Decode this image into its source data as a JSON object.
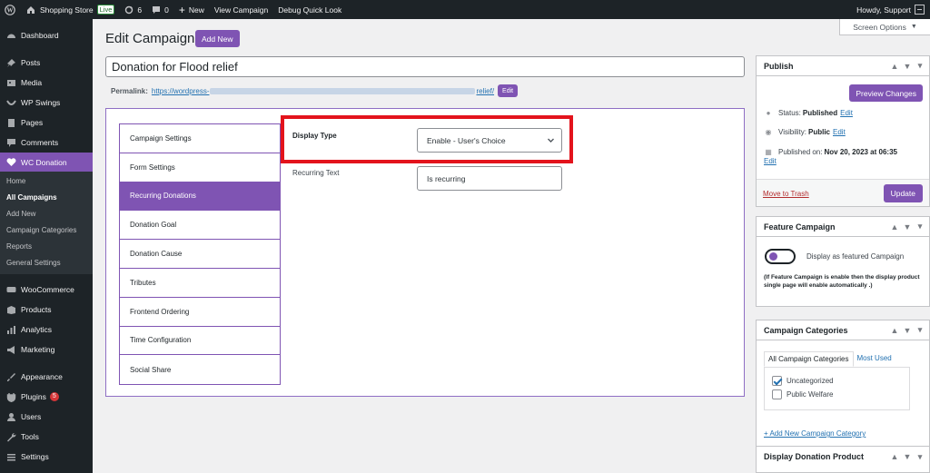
{
  "adminbar": {
    "site_name": "Shopping Store",
    "live_badge": "Live",
    "updates_count": "6",
    "comments_count": "0",
    "new_label": "New",
    "view_campaign": "View Campaign",
    "debug": "Debug Quick Look",
    "howdy": "Howdy, Support"
  },
  "sidebar": {
    "dashboard": "Dashboard",
    "posts": "Posts",
    "media": "Media",
    "wp_swings": "WP Swings",
    "pages": "Pages",
    "comments": "Comments",
    "wc_donation": "WC Donation",
    "sub": {
      "home": "Home",
      "all_campaigns": "All Campaigns",
      "add_new": "Add New",
      "campaign_categories": "Campaign Categories",
      "reports": "Reports",
      "general_settings": "General Settings"
    },
    "woocommerce": "WooCommerce",
    "products": "Products",
    "analytics": "Analytics",
    "marketing": "Marketing",
    "appearance": "Appearance",
    "plugins": "Plugins",
    "plugins_badge": "5",
    "users": "Users",
    "tools": "Tools",
    "settings": "Settings"
  },
  "header": {
    "title": "Edit Campaign",
    "add_new": "Add New",
    "screen_options": "Screen Options"
  },
  "post": {
    "title_value": "Donation for Flood relief",
    "permalink_label": "Permalink:",
    "permalink_start": "https://wordpress-",
    "permalink_end": "relief/",
    "edit_label": "Edit"
  },
  "campaign": {
    "tabs": [
      "Campaign Settings",
      "Form Settings",
      "Recurring Donations",
      "Donation Goal",
      "Donation Cause",
      "Tributes",
      "Frontend Ordering",
      "Time Configuration",
      "Social Share"
    ],
    "active_tab": "Recurring Donations",
    "display_type_label": "Display Type",
    "display_type_value": "Enable - User's Choice",
    "recurring_text_label": "Recurring Text",
    "recurring_text_value": "Is recurring"
  },
  "publish": {
    "heading": "Publish",
    "preview": "Preview Changes",
    "status_label": "Status:",
    "status_value": "Published",
    "visibility_label": "Visibility:",
    "visibility_value": "Public",
    "published_label": "Published on:",
    "published_value": "Nov 20, 2023 at 06:35",
    "edit": "Edit",
    "trash": "Move to Trash",
    "update": "Update"
  },
  "feature": {
    "heading": "Feature Campaign",
    "toggle_label": "Display as featured Campaign",
    "toggle_on": true,
    "note": "(If Feature Campaign is enable then the display product single page will enable automatically .)"
  },
  "categories": {
    "heading": "Campaign Categories",
    "tab_all": "All Campaign Categories",
    "tab_most": "Most Used",
    "items": [
      {
        "label": "Uncategorized",
        "checked": true
      },
      {
        "label": "Public Welfare",
        "checked": false
      }
    ],
    "add_new": "+ Add New Campaign Category"
  },
  "display_donation": {
    "heading": "Display Donation Product"
  },
  "colors": {
    "accent": "#7f54b3",
    "admin_bar": "#1d2327",
    "highlight": "#e3131c",
    "link": "#2271b1"
  }
}
